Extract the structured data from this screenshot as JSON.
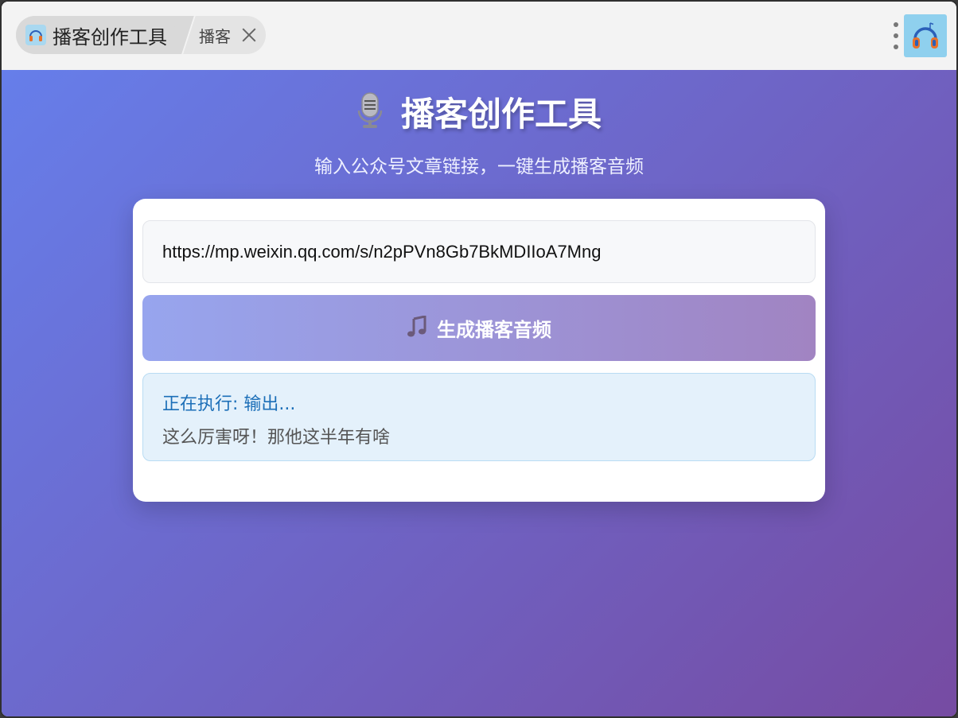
{
  "titlebar": {
    "tab_title": "播客创作工具",
    "tab_sub_label": "播客",
    "close_icon": "close-icon",
    "menu_icon": "kebab-menu-icon",
    "app_icon": "headphones-icon"
  },
  "header": {
    "icon": "microphone-icon",
    "title": "播客创作工具",
    "subtitle": "输入公众号文章链接，一键生成播客音频"
  },
  "form": {
    "url_value": "https://mp.weixin.qq.com/s/n2pPVn8Gb7BkMDIIoA7Mng",
    "generate_icon": "music-note-icon",
    "generate_label": "生成播客音频"
  },
  "status": {
    "line": "正在执行: 输出...",
    "text": "这么厉害呀！那他这半年有啥"
  },
  "colors": {
    "gradient_start": "#667eea",
    "gradient_end": "#764ba2",
    "status_text": "#1c6fb8"
  }
}
